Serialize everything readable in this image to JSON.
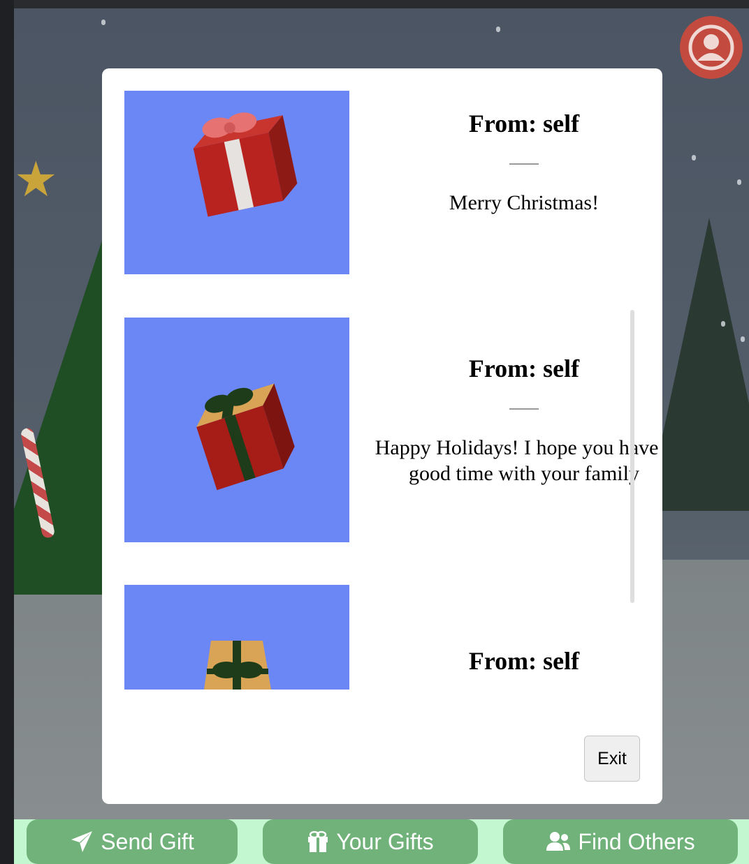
{
  "gifts": [
    {
      "from": "From: self",
      "message": "Merry Christmas!",
      "box_color": "#b9231f",
      "ribbon_color": "#e6e2df",
      "bow_color": "#e67272"
    },
    {
      "from": "From: self",
      "message": "Happy Holidays! I hope you have a good time with your family",
      "box_color": "#a61c16",
      "ribbon_color": "#1e3b1a",
      "lid_color": "#d9a455"
    },
    {
      "from": "From: self",
      "message": "",
      "box_color": "#d9a455",
      "ribbon_color": "#1e3b1a"
    }
  ],
  "modal": {
    "exit_label": "Exit"
  },
  "nav": {
    "send_gift": "Send Gift",
    "your_gifts": "Your Gifts",
    "find_others": "Find Others"
  },
  "colors": {
    "thumb_bg": "#6b87f6",
    "nav_bg": "#c2f7cf",
    "nav_button": "#70b27a",
    "profile": "#c24a3e"
  },
  "icons": [
    "paper-plane-icon",
    "gift-icon",
    "users-icon",
    "user-circle-icon"
  ]
}
